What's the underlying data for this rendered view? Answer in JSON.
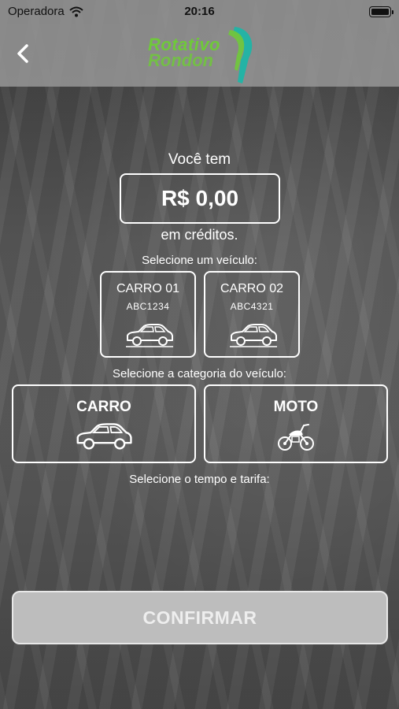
{
  "status_bar": {
    "carrier": "Operadora",
    "time": "20:16"
  },
  "header": {
    "logo_line1": "Rotativo",
    "logo_line2": "Rondon"
  },
  "credits": {
    "prefix": "Você tem",
    "amount": "R$ 0,00",
    "suffix": "em créditos."
  },
  "vehicles": {
    "label": "Selecione um veículo:",
    "items": [
      {
        "name": "CARRO 01",
        "plate": "ABC1234",
        "icon": "car-icon"
      },
      {
        "name": "CARRO 02",
        "plate": "ABC4321",
        "icon": "car-icon"
      }
    ]
  },
  "category": {
    "label": "Selecione a categoria do veículo:",
    "items": [
      {
        "name": "CARRO",
        "icon": "car-icon"
      },
      {
        "name": "MOTO",
        "icon": "motorcycle-icon"
      }
    ]
  },
  "tariff": {
    "label": "Selecione o tempo e tarifa:"
  },
  "confirm_button": {
    "label": "CONFIRMAR"
  },
  "colors": {
    "logo_green": "#6fc93a",
    "logo_teal": "#1fb5a6",
    "button_bg": "#bdbdbd"
  }
}
